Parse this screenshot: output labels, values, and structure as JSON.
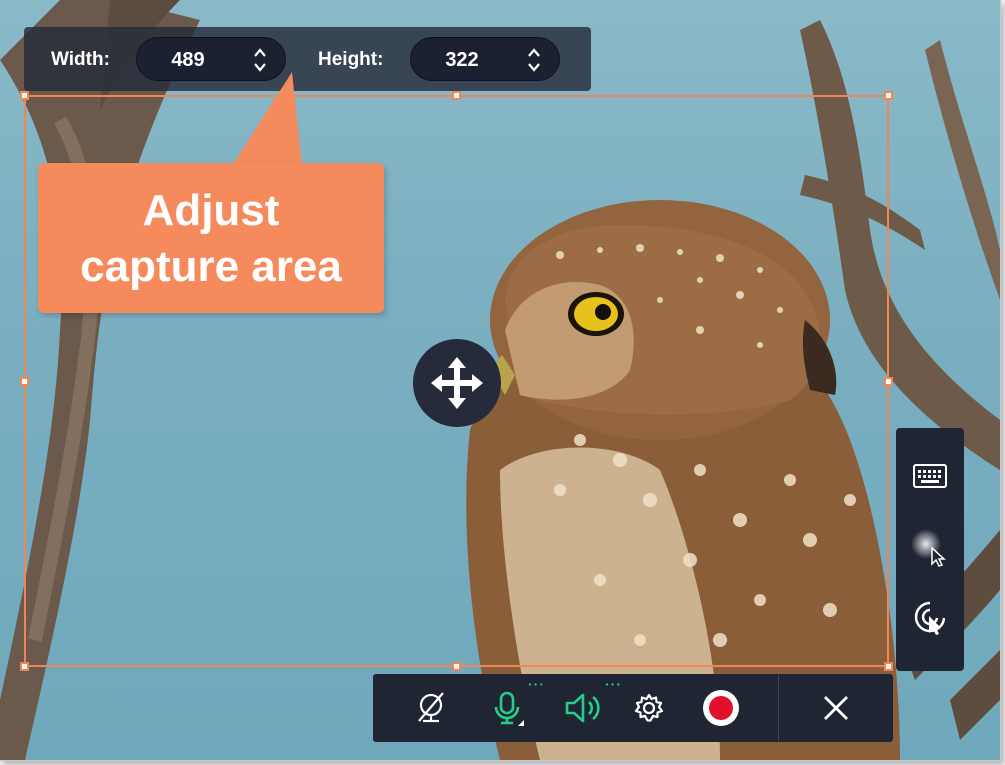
{
  "capture": {
    "width_label": "Width:",
    "width_value": "489",
    "height_label": "Height:",
    "height_value": "322"
  },
  "callout": {
    "line1": "Adjust",
    "line2": "capture area"
  },
  "colors": {
    "accent": "#f28456",
    "callout": "#f58a5d",
    "toolbar": "#1f2533",
    "active_green": "#22d08a",
    "record_red": "#e0112b"
  },
  "icons": {
    "move": "move-arrows-icon",
    "keyboard": "keyboard-icon",
    "cursor_highlight": "cursor-highlight-icon",
    "click_effect": "click-effect-icon",
    "webcam": "webcam-off-icon",
    "microphone": "microphone-icon",
    "speaker": "speaker-icon",
    "settings": "gear-icon",
    "record": "record-icon",
    "close": "close-icon"
  }
}
